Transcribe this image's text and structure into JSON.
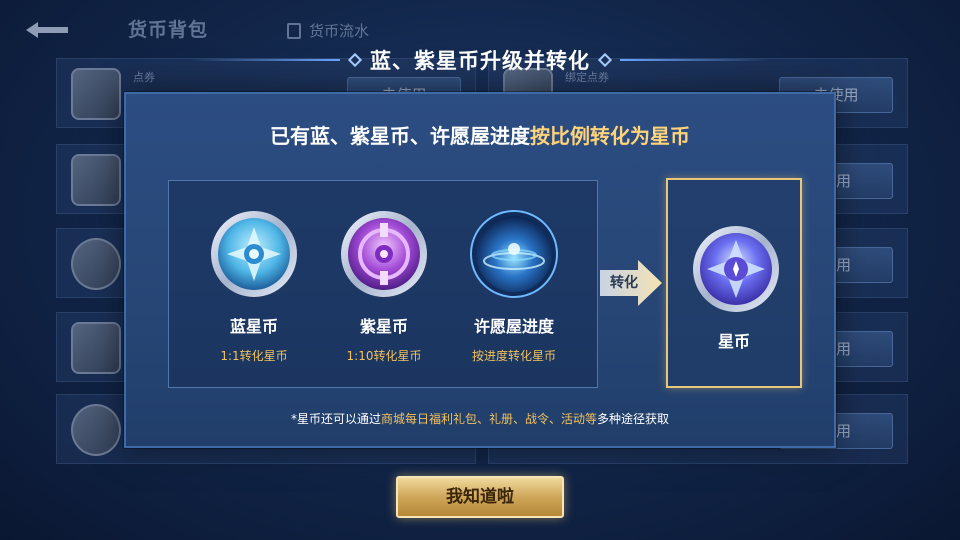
{
  "background": {
    "title": "货币背包",
    "tab_flow": "货币流水",
    "rows": [
      {
        "label": "点券",
        "button": "去使用"
      },
      {
        "label": "绑定点券",
        "button": "去使用"
      },
      {
        "label": "",
        "button": "使用"
      },
      {
        "label": "",
        "button": "使用"
      },
      {
        "label": "",
        "button": "使用"
      },
      {
        "label": "",
        "button": "使用"
      },
      {
        "label": "",
        "button": "使用"
      },
      {
        "label": "",
        "button": "使用"
      }
    ]
  },
  "dialog": {
    "title": "蓝、紫星币升级并转化",
    "heading_part1": "已有蓝、紫星币、许愿屋进度",
    "heading_part2": "按比例转化为",
    "heading_part3": "星币",
    "sources": [
      {
        "name": "蓝星币",
        "desc": "1:1转化星币",
        "icon": "blue-star-coin-icon"
      },
      {
        "name": "紫星币",
        "desc": "1:10转化星币",
        "icon": "purple-star-coin-icon"
      },
      {
        "name": "许愿屋进度",
        "desc": "按进度转化星币",
        "icon": "wish-house-progress-icon"
      }
    ],
    "convert_label": "转化",
    "target": {
      "name": "星币",
      "icon": "star-coin-icon"
    },
    "footnote_prefix": "*星币还可以通过",
    "footnote_highlight": "商城每日福利礼包、礼册、战令、活动等",
    "footnote_suffix": "多种途径获取"
  },
  "confirm_button": "我知道啦",
  "colors": {
    "accent_gold": "#f2c15c",
    "panel_blue": "#2c4d82",
    "highlight_border": "#e8c67a"
  }
}
